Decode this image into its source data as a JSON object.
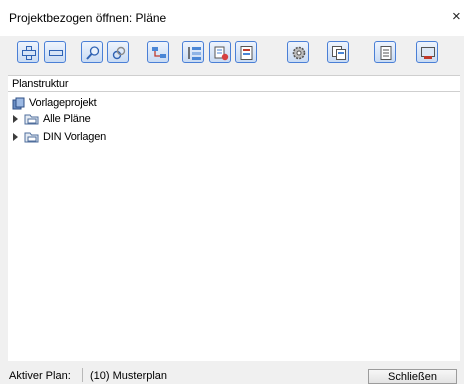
{
  "window": {
    "title": "Projektbezogen öffnen: Pläne",
    "close_glyph": "×"
  },
  "toolbar": {
    "buttons": [
      {
        "name": "expand-all-icon"
      },
      {
        "name": "collapse-all-icon"
      },
      {
        "name": "search-icon"
      },
      {
        "name": "link-icon"
      },
      {
        "name": "structure-level-icon"
      },
      {
        "name": "sort-icon"
      },
      {
        "name": "delete-structure-icon"
      },
      {
        "name": "plan-list-icon"
      },
      {
        "name": "gear-icon"
      },
      {
        "name": "copy-plan-icon"
      },
      {
        "name": "document-icon"
      },
      {
        "name": "plot-icon"
      }
    ]
  },
  "tree": {
    "header": "Planstruktur",
    "root": {
      "label": "Vorlageprojekt",
      "icon": "project-icon"
    },
    "items": [
      {
        "label": "Alle Pläne",
        "icon": "folder-icon",
        "collapsed": true
      },
      {
        "label": "DIN Vorlagen",
        "icon": "folder-icon",
        "collapsed": true
      }
    ]
  },
  "status": {
    "label": "Aktiver Plan:",
    "value": "(10)  Musterplan"
  },
  "buttons": {
    "close_label": "Schließen"
  },
  "colors": {
    "accent": "#4a7fd6",
    "folder": "#6b8fc4"
  }
}
